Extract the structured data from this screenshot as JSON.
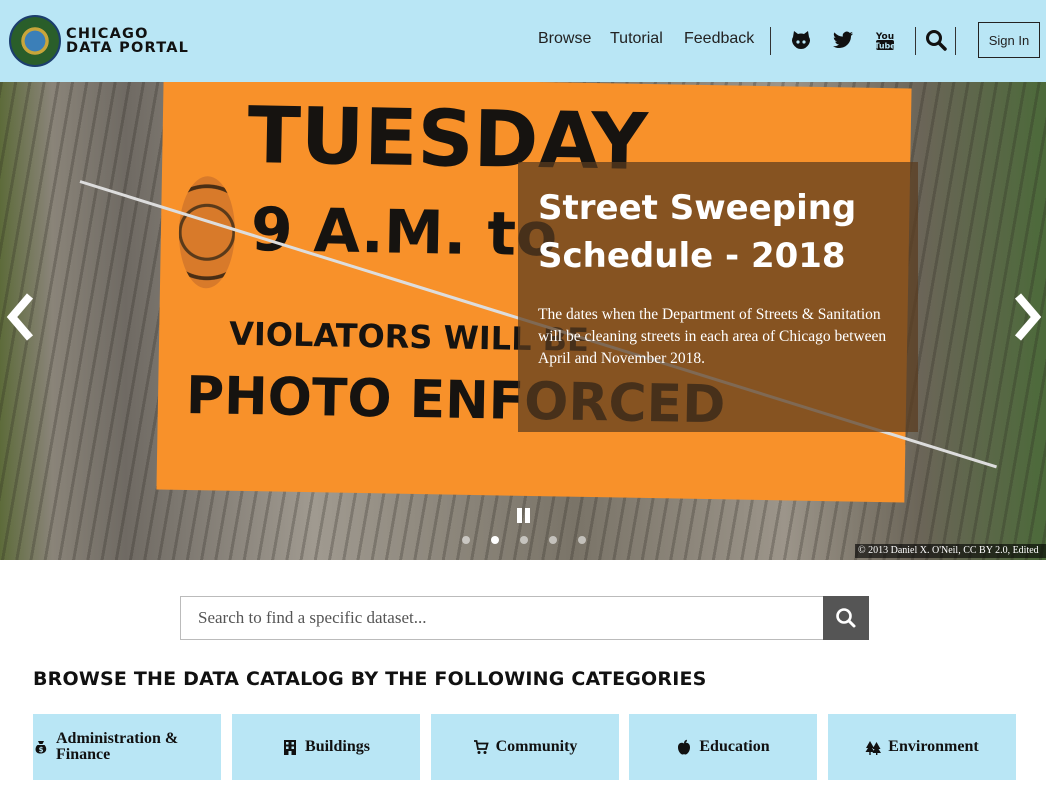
{
  "header": {
    "brand_line1": "CHICAGO",
    "brand_line2": "DATA PORTAL",
    "nav": [
      "Browse",
      "Tutorial",
      "Feedback"
    ],
    "social_icons": [
      "github-icon",
      "twitter-icon",
      "youtube-icon"
    ],
    "search_icon": "search-icon",
    "signin_label": "Sign In",
    "bg_color": "#b9e6f5"
  },
  "hero": {
    "sign_lines": [
      "TUESDAY",
      "9 A.M. to",
      "VIOLATORS WILL BE",
      "PHOTO ENFORCED"
    ],
    "title": "Street Sweeping Schedule - 2018",
    "description": "The dates when the Department of Streets & Sanitation will be cleaning streets in each area of Chicago between April and November 2018.",
    "credit": "© 2013 Daniel X. O'Neil, CC BY 2.0, Edited",
    "slide_count": 5,
    "active_slide": 2
  },
  "search": {
    "placeholder": "Search to find a specific dataset..."
  },
  "catalog": {
    "heading": "BROWSE THE DATA CATALOG BY THE FOLLOWING CATEGORIES",
    "categories": [
      {
        "label": "Administration & Finance",
        "icon": "money-bag-icon"
      },
      {
        "label": "Buildings",
        "icon": "building-icon"
      },
      {
        "label": "Community",
        "icon": "cart-icon"
      },
      {
        "label": "Education",
        "icon": "apple-icon"
      },
      {
        "label": "Environment",
        "icon": "trees-icon"
      }
    ]
  }
}
